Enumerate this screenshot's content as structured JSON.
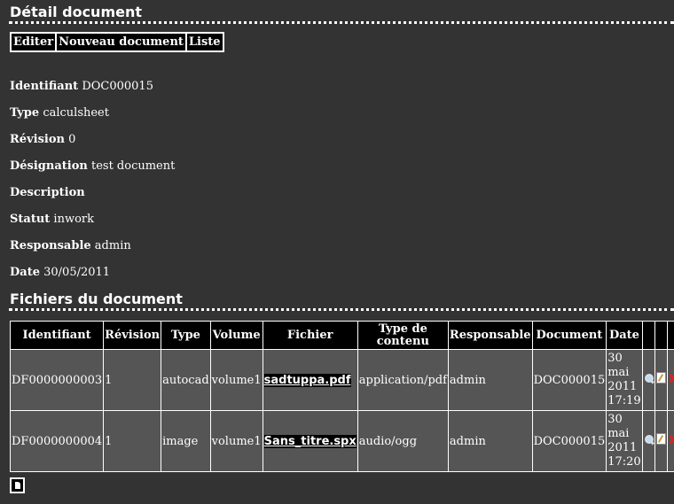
{
  "detail": {
    "title": "Détail document",
    "actions": [
      "Editer",
      "Nouveau document",
      "Liste"
    ],
    "fields": [
      {
        "label": "Identifiant",
        "value": "DOC000015"
      },
      {
        "label": "Type",
        "value": "calculsheet"
      },
      {
        "label": "Révision",
        "value": "0"
      },
      {
        "label": "Désignation",
        "value": "test document"
      },
      {
        "label": "Description",
        "value": ""
      },
      {
        "label": "Statut",
        "value": "inwork"
      },
      {
        "label": "Responsable",
        "value": "admin"
      },
      {
        "label": "Date",
        "value": "30/05/2011"
      }
    ]
  },
  "files": {
    "title": "Fichiers du document",
    "columns": [
      "Identifiant",
      "Révision",
      "Type",
      "Volume",
      "Fichier",
      "Type de contenu",
      "Responsable",
      "Document",
      "Date"
    ],
    "rows": [
      {
        "id": "DF0000000003",
        "revision": "1",
        "type": "autocad",
        "volume": "volume1",
        "fichier": "sadtuppa.pdf",
        "content_type": "application/pdf",
        "responsable": "admin",
        "document": "DOC000015",
        "date": "30 mai 2011 17:19"
      },
      {
        "id": "DF0000000004",
        "revision": "1",
        "type": "image",
        "volume": "volume1",
        "fichier": "Sans_titre.spx",
        "content_type": "audio/ogg",
        "responsable": "admin",
        "document": "DOC000015",
        "date": "30 mai 2011 17:20"
      }
    ],
    "row_icons": [
      "view-icon",
      "edit-icon",
      "delete-icon"
    ],
    "new_file_icon": "new-file-icon"
  }
}
